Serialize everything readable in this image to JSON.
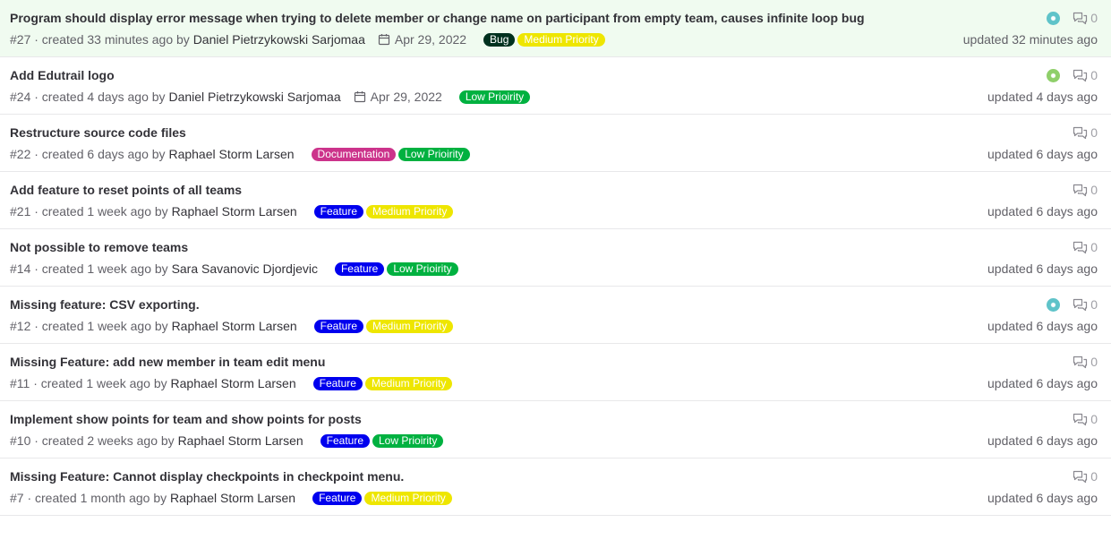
{
  "issues": [
    {
      "title": "Program should display error message when trying to delete member or change name on participant from empty team, causes infinite loop bug",
      "number": "#27",
      "created": "· created 33 minutes ago by",
      "author": "Daniel Pietrzykowski Sarjomaa",
      "due": "Apr 29, 2022",
      "labels": [
        {
          "text": "Bug",
          "bg": "#00311f",
          "fg": "#ffffff"
        },
        {
          "text": "Medium Priority",
          "bg": "#eee600",
          "fg": "#ffffff"
        }
      ],
      "avatar": "teal",
      "comments": "0",
      "updated": "updated 32 minutes ago",
      "highlight": true
    },
    {
      "title": "Add Edutrail logo",
      "number": "#24",
      "created": "· created 4 days ago by",
      "author": "Daniel Pietrzykowski Sarjomaa",
      "due": "Apr 29, 2022",
      "labels": [
        {
          "text": "Low Prioirity",
          "bg": "#00b140",
          "fg": "#ffffff"
        }
      ],
      "avatar": "green",
      "comments": "0",
      "updated": "updated 4 days ago"
    },
    {
      "title": "Restructure source code files",
      "number": "#22",
      "created": "· created 6 days ago by",
      "author": "Raphael Storm Larsen",
      "due": "",
      "labels": [
        {
          "text": "Documentation",
          "bg": "#cc338b",
          "fg": "#ffffff"
        },
        {
          "text": "Low Prioirity",
          "bg": "#00b140",
          "fg": "#ffffff"
        }
      ],
      "avatar": "",
      "comments": "0",
      "updated": "updated 6 days ago"
    },
    {
      "title": "Add feature to reset points of all teams",
      "number": "#21",
      "created": "· created 1 week ago by",
      "author": "Raphael Storm Larsen",
      "due": "",
      "labels": [
        {
          "text": "Feature",
          "bg": "#0000ee",
          "fg": "#ffffff"
        },
        {
          "text": "Medium Priority",
          "bg": "#eee600",
          "fg": "#ffffff"
        }
      ],
      "avatar": "",
      "comments": "0",
      "updated": "updated 6 days ago"
    },
    {
      "title": "Not possible to remove teams",
      "number": "#14",
      "created": "· created 1 week ago by",
      "author": "Sara Savanovic Djordjevic",
      "due": "",
      "labels": [
        {
          "text": "Feature",
          "bg": "#0000ee",
          "fg": "#ffffff"
        },
        {
          "text": "Low Prioirity",
          "bg": "#00b140",
          "fg": "#ffffff"
        }
      ],
      "avatar": "",
      "comments": "0",
      "updated": "updated 6 days ago"
    },
    {
      "title": "Missing feature: CSV exporting.",
      "number": "#12",
      "created": "· created 1 week ago by",
      "author": "Raphael Storm Larsen",
      "due": "",
      "labels": [
        {
          "text": "Feature",
          "bg": "#0000ee",
          "fg": "#ffffff"
        },
        {
          "text": "Medium Priority",
          "bg": "#eee600",
          "fg": "#ffffff"
        }
      ],
      "avatar": "teal",
      "comments": "0",
      "updated": "updated 6 days ago"
    },
    {
      "title": "Missing Feature: add new member in team edit menu",
      "number": "#11",
      "created": "· created 1 week ago by",
      "author": "Raphael Storm Larsen",
      "due": "",
      "labels": [
        {
          "text": "Feature",
          "bg": "#0000ee",
          "fg": "#ffffff"
        },
        {
          "text": "Medium Priority",
          "bg": "#eee600",
          "fg": "#ffffff"
        }
      ],
      "avatar": "",
      "comments": "0",
      "updated": "updated 6 days ago"
    },
    {
      "title": "Implement show points for team and show points for posts",
      "number": "#10",
      "created": "· created 2 weeks ago by",
      "author": "Raphael Storm Larsen",
      "due": "",
      "labels": [
        {
          "text": "Feature",
          "bg": "#0000ee",
          "fg": "#ffffff"
        },
        {
          "text": "Low Prioirity",
          "bg": "#00b140",
          "fg": "#ffffff"
        }
      ],
      "avatar": "",
      "comments": "0",
      "updated": "updated 6 days ago"
    },
    {
      "title": "Missing Feature: Cannot display checkpoints in checkpoint menu.",
      "number": "#7",
      "created": "· created 1 month ago by",
      "author": "Raphael Storm Larsen",
      "due": "",
      "labels": [
        {
          "text": "Feature",
          "bg": "#0000ee",
          "fg": "#ffffff"
        },
        {
          "text": "Medium Priority",
          "bg": "#eee600",
          "fg": "#ffffff"
        }
      ],
      "avatar": "",
      "comments": "0",
      "updated": "updated 6 days ago"
    }
  ],
  "colors": {
    "avatar_teal": "#5fc3c9",
    "avatar_green": "#8fcf6a"
  }
}
